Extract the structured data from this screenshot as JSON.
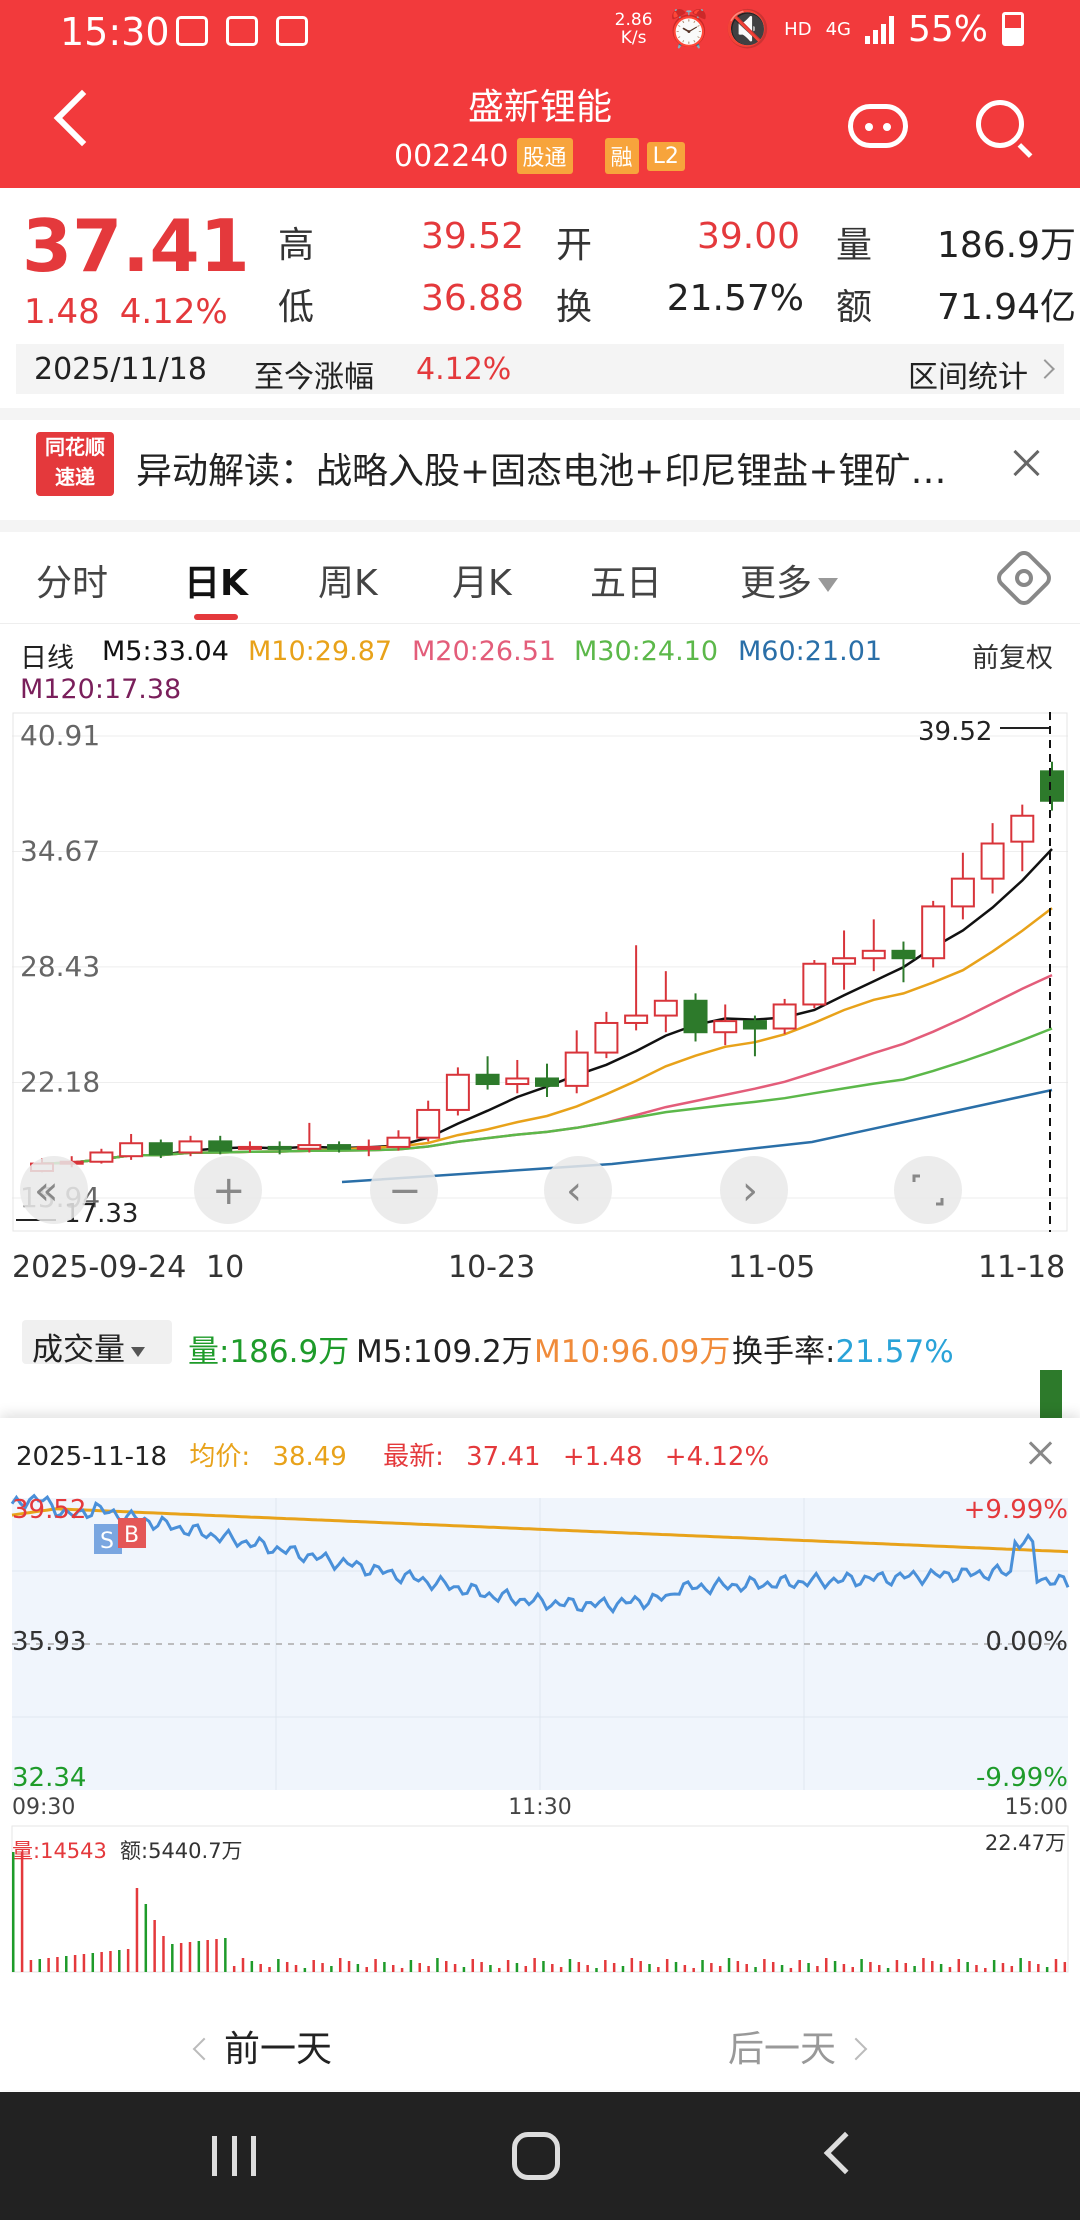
{
  "status_bar": {
    "time": "15:30",
    "net_speed": "2.86",
    "net_speed_unit": "K/s",
    "hd": "HD",
    "network": "4G",
    "battery": "55%"
  },
  "header": {
    "title": "盛新锂能",
    "code": "002240",
    "tag1": "股通",
    "tag2": "融",
    "tag3": "L2"
  },
  "quote": {
    "price": "37.41",
    "change": "1.48",
    "change_pct": "4.12%",
    "high_label": "高",
    "high": "39.52",
    "open_label": "开",
    "open": "39.00",
    "vol_label": "量",
    "vol": "186.9万",
    "low_label": "低",
    "low": "36.88",
    "turnover_label": "换",
    "turnover": "21.57%",
    "amount_label": "额",
    "amount": "71.94亿",
    "date": "2025/11/18",
    "since_label": "至今涨幅",
    "since_pct": "4.12%",
    "range_stats": "区间统计"
  },
  "news": {
    "logo_line1": "同花顺",
    "logo_line2": "速递",
    "text": "异动解读：战略入股+固态电池+印尼锂盐+锂矿…"
  },
  "tabs": [
    {
      "label": "分时"
    },
    {
      "label": "日K"
    },
    {
      "label": "周K"
    },
    {
      "label": "月K"
    },
    {
      "label": "五日"
    },
    {
      "label": "更多"
    }
  ],
  "ma": {
    "line_label": "日线",
    "m5": "M5:33.04",
    "m10": "M10:29.87",
    "m20": "M20:26.51",
    "m30": "M30:24.10",
    "m60": "M60:21.01",
    "m120": "M120:17.38",
    "adjust": "前复权",
    "colors": {
      "m5": "#111111",
      "m10": "#e8a21a",
      "m20": "#e35d7a",
      "m30": "#5cb84a",
      "m60": "#2a6fa8",
      "m120": "#7a1f5b"
    }
  },
  "chart_data": [
    {
      "type": "candlestick",
      "title": "日K",
      "y_ticks": [
        "40.91",
        "34.67",
        "28.43",
        "22.18",
        "15.94"
      ],
      "ylim": [
        15.94,
        40.91
      ],
      "max_label": "39.52",
      "min_label": "17.33",
      "x_tick_labels": [
        "2025-09-24",
        "10",
        "10-23",
        "11-05",
        "11-18"
      ],
      "candles": [
        {
          "o": 17.4,
          "c": 17.8,
          "h": 18.1,
          "l": 17.33
        },
        {
          "o": 17.8,
          "c": 17.9,
          "h": 18.2,
          "l": 17.6
        },
        {
          "o": 17.9,
          "c": 18.4,
          "h": 18.6,
          "l": 17.8
        },
        {
          "o": 18.2,
          "c": 18.9,
          "h": 19.4,
          "l": 18.0
        },
        {
          "o": 18.9,
          "c": 18.3,
          "h": 19.1,
          "l": 18.1
        },
        {
          "o": 18.4,
          "c": 19.0,
          "h": 19.3,
          "l": 18.2
        },
        {
          "o": 19.0,
          "c": 18.5,
          "h": 19.3,
          "l": 18.3
        },
        {
          "o": 18.6,
          "c": 18.7,
          "h": 19.0,
          "l": 18.4
        },
        {
          "o": 18.7,
          "c": 18.6,
          "h": 19.0,
          "l": 18.3
        },
        {
          "o": 18.6,
          "c": 18.8,
          "h": 20.0,
          "l": 18.4
        },
        {
          "o": 18.8,
          "c": 18.6,
          "h": 19.0,
          "l": 18.4
        },
        {
          "o": 18.6,
          "c": 18.7,
          "h": 19.1,
          "l": 18.2
        },
        {
          "o": 18.7,
          "c": 19.2,
          "h": 19.6,
          "l": 18.5
        },
        {
          "o": 19.2,
          "c": 20.7,
          "h": 21.2,
          "l": 19.0
        },
        {
          "o": 20.7,
          "c": 22.6,
          "h": 23.0,
          "l": 20.4
        },
        {
          "o": 22.6,
          "c": 22.1,
          "h": 23.6,
          "l": 21.8
        },
        {
          "o": 22.1,
          "c": 22.4,
          "h": 23.4,
          "l": 21.6
        },
        {
          "o": 22.4,
          "c": 22.0,
          "h": 23.2,
          "l": 21.4
        },
        {
          "o": 22.0,
          "c": 23.8,
          "h": 25.0,
          "l": 21.6
        },
        {
          "o": 23.8,
          "c": 25.4,
          "h": 26.0,
          "l": 23.5
        },
        {
          "o": 25.4,
          "c": 25.8,
          "h": 29.6,
          "l": 25.0
        },
        {
          "o": 25.8,
          "c": 26.6,
          "h": 28.2,
          "l": 24.9
        },
        {
          "o": 26.6,
          "c": 24.9,
          "h": 27.0,
          "l": 24.4
        },
        {
          "o": 24.9,
          "c": 25.5,
          "h": 26.4,
          "l": 24.2
        },
        {
          "o": 25.5,
          "c": 25.1,
          "h": 25.8,
          "l": 23.6
        },
        {
          "o": 25.1,
          "c": 26.4,
          "h": 26.7,
          "l": 24.8
        },
        {
          "o": 26.4,
          "c": 28.6,
          "h": 28.8,
          "l": 26.2
        },
        {
          "o": 28.6,
          "c": 28.9,
          "h": 30.4,
          "l": 27.2
        },
        {
          "o": 28.9,
          "c": 29.3,
          "h": 31.0,
          "l": 28.2
        },
        {
          "o": 29.3,
          "c": 28.9,
          "h": 29.8,
          "l": 27.6
        },
        {
          "o": 28.9,
          "c": 31.7,
          "h": 32.0,
          "l": 28.4
        },
        {
          "o": 31.7,
          "c": 33.2,
          "h": 34.6,
          "l": 31.0
        },
        {
          "o": 33.2,
          "c": 35.1,
          "h": 36.2,
          "l": 32.4
        },
        {
          "o": 35.2,
          "c": 36.6,
          "h": 37.2,
          "l": 33.6
        },
        {
          "o": 39.0,
          "c": 37.41,
          "h": 39.52,
          "l": 36.88
        }
      ]
    },
    {
      "type": "line",
      "title": "分时",
      "date": "2025-11-18",
      "avg_label": "均价:",
      "avg": "38.49",
      "last_label": "最新:",
      "last": "37.41",
      "last_change": "+1.48",
      "last_pct": "+4.12%",
      "ylim": [
        32.34,
        39.52
      ],
      "y_left": [
        "39.52",
        "35.93",
        "32.34"
      ],
      "y_right": [
        "+9.99%",
        "0.00%",
        "-9.99%"
      ],
      "x_labels": [
        "09:30",
        "11:30",
        "15:00"
      ],
      "vol_label": "量:",
      "vol_value": "14543",
      "amt_label": "额:",
      "amt_value": "5440.7万",
      "vol_max": "22.47万"
    }
  ],
  "volume": {
    "selector": "成交量",
    "vol_label": "量:",
    "vol": "186.9万",
    "m5_label": "M5:",
    "m5": "109.2万",
    "m10_label": "M10:",
    "m10": "96.09万",
    "turnover_label": "换手率:",
    "turnover": "21.57%"
  },
  "day_nav": {
    "prev": "前一天",
    "next": "后一天"
  }
}
